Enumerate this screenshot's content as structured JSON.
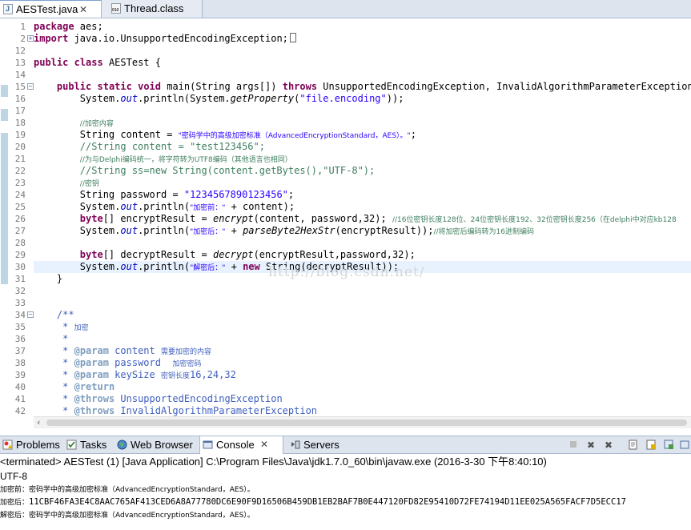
{
  "editor_tabs": [
    {
      "label": "AESTest.java",
      "icon": "java-file-icon",
      "close": "✕",
      "active": true
    },
    {
      "label": "Thread.class",
      "icon": "class-file-icon",
      "active": false
    }
  ],
  "code_lines": [
    {
      "n": "1"
    },
    {
      "n": "2"
    },
    {
      "n": "12"
    },
    {
      "n": "13"
    },
    {
      "n": "14"
    },
    {
      "n": "15"
    },
    {
      "n": "16"
    },
    {
      "n": "17"
    },
    {
      "n": "18"
    },
    {
      "n": "19"
    },
    {
      "n": "20"
    },
    {
      "n": "21"
    },
    {
      "n": "22"
    },
    {
      "n": "23"
    },
    {
      "n": "24"
    },
    {
      "n": "25"
    },
    {
      "n": "26"
    },
    {
      "n": "27"
    },
    {
      "n": "28"
    },
    {
      "n": "29"
    },
    {
      "n": "30"
    },
    {
      "n": "31"
    },
    {
      "n": "32"
    },
    {
      "n": "33"
    },
    {
      "n": "34"
    },
    {
      "n": "35"
    },
    {
      "n": "36"
    },
    {
      "n": "37"
    },
    {
      "n": "38"
    },
    {
      "n": "39"
    },
    {
      "n": "40"
    },
    {
      "n": "41"
    },
    {
      "n": "42"
    }
  ],
  "code": {
    "l1_kw": "package",
    "l1_rest": " aes;",
    "l2_kw": "import",
    "l2_rest": " java.io.UnsupportedEncodingException;",
    "l13_kw1": "public",
    "l13_kw2": "class",
    "l13_rest": " AESTest {",
    "l15_kw1": "public",
    "l15_kw2": "static",
    "l15_kw3": "void",
    "l15_mid": " main(String args[]) ",
    "l15_kw4": "throws",
    "l15_rest": " UnsupportedEncodingException, InvalidAlgorithmParameterException{",
    "l16_a": "System.",
    "l16_out": "out",
    "l16_b": ".println(System.",
    "l16_m": "getProperty",
    "l16_c": "(",
    "l16_s": "\"file.encoding\"",
    "l16_d": "));",
    "l18_c": "//加密内容",
    "l19_a": "String content = ",
    "l19_s": "\"密码学中的高级加密标准（AdvancedEncryptionStandard，AES）。\"",
    "l19_b": ";",
    "l20_c": "//String content = \"test123456\";",
    "l21_c": "//为与Delphi编码统一，将字符转为UTF8编码（其他语言也相同）",
    "l22_c": "//String ss=new String(content.getBytes(),\"UTF-8\");",
    "l23_c": "//密钥",
    "l24_a": "String password = ",
    "l24_s": "\"1234567890123456\"",
    "l24_b": ";",
    "l25_a": "System.",
    "l25_out": "out",
    "l25_b": ".println(",
    "l25_s": "\"加密前：\"",
    "l25_c": " + content);",
    "l26_a": "byte",
    "l26_b": "[] encryptResult = ",
    "l26_m": "encrypt",
    "l26_c": "(content, password,32); ",
    "l26_cm": "//16位密钥长度128位、24位密钥长度192、32位密钥长度256（在delphi中对应kb128",
    "l27_a": "System.",
    "l27_out": "out",
    "l27_b": ".println(",
    "l27_s": "\"加密后：\"",
    "l27_c": " + ",
    "l27_m": "parseByte2HexStr",
    "l27_d": "(encryptResult));",
    "l27_cm": "//将加密后编码转为16进制编码",
    "l29_a": "byte",
    "l29_b": "[] decryptResult = ",
    "l29_m": "decrypt",
    "l29_c": "(encryptResult,password,32);",
    "l30_a": "System.",
    "l30_out": "out",
    "l30_b": ".println(",
    "l30_s": "\"解密后：\"",
    "l30_c": " + ",
    "l30_kw": "new",
    "l30_d": " String(decryptResult));",
    "l31": "}",
    "l34": "/**",
    "l35": " * ",
    "l35_cj": "加密",
    "l36": " *",
    "l37_a": " * ",
    "l37_t": "@param",
    "l37_b": " content ",
    "l37_cj": "需要加密的内容",
    "l38_a": " * ",
    "l38_t": "@param",
    "l38_b": " password  ",
    "l38_cj": "加密密码",
    "l39_a": " * ",
    "l39_t": "@param",
    "l39_b": " keySize ",
    "l39_cj": "密钥长度",
    "l39_c": "16,24,32",
    "l40_a": " * ",
    "l40_t": "@return",
    "l41_a": " * ",
    "l41_t": "@throws",
    "l41_b": " UnsupportedEncodingException",
    "l42_a": " * ",
    "l42_t": "@throws",
    "l42_b": " InvalidAlgorithmParameterException"
  },
  "watermark": "http://blog.csdn.net/",
  "view_tabs": [
    {
      "label": "Problems",
      "icon": "problems-icon"
    },
    {
      "label": "Tasks",
      "icon": "tasks-icon"
    },
    {
      "label": "Web Browser",
      "icon": "globe-icon"
    },
    {
      "label": "Console",
      "icon": "console-icon",
      "close": "✕",
      "active": true
    },
    {
      "label": "Servers",
      "icon": "servers-icon"
    }
  ],
  "console": {
    "terminated": "<terminated> AESTest (1) [Java Application] C:\\Program Files\\Java\\jdk1.7.0_60\\bin\\javaw.exe (2016-3-30 下午8:40:10)",
    "line1": "UTF-8",
    "line2_label": "加密前：",
    "line2_text": "密码学中的高级加密标准（AdvancedEncryptionStandard，AES）。",
    "line3_label": "加密后：",
    "line3_text": "11CBF46FA3E4C8AAC765AF413CED6A8A77780DC6E90F9D16506B459DB1EB2BAF7B0E447120FD82E95410D72FE74194D11EE025A565FACF7D5ECC17",
    "line4_label": "解密后：",
    "line4_text": "密码学中的高级加密标准（AdvancedEncryptionStandard，AES）。"
  },
  "colors": {
    "keyword": "#7f0055",
    "string": "#2a00ff",
    "comment": "#3f7f5f",
    "field": "#0000c0",
    "javadoc": "#3f5fbf",
    "javadoc_tag": "#7f9fbf"
  }
}
